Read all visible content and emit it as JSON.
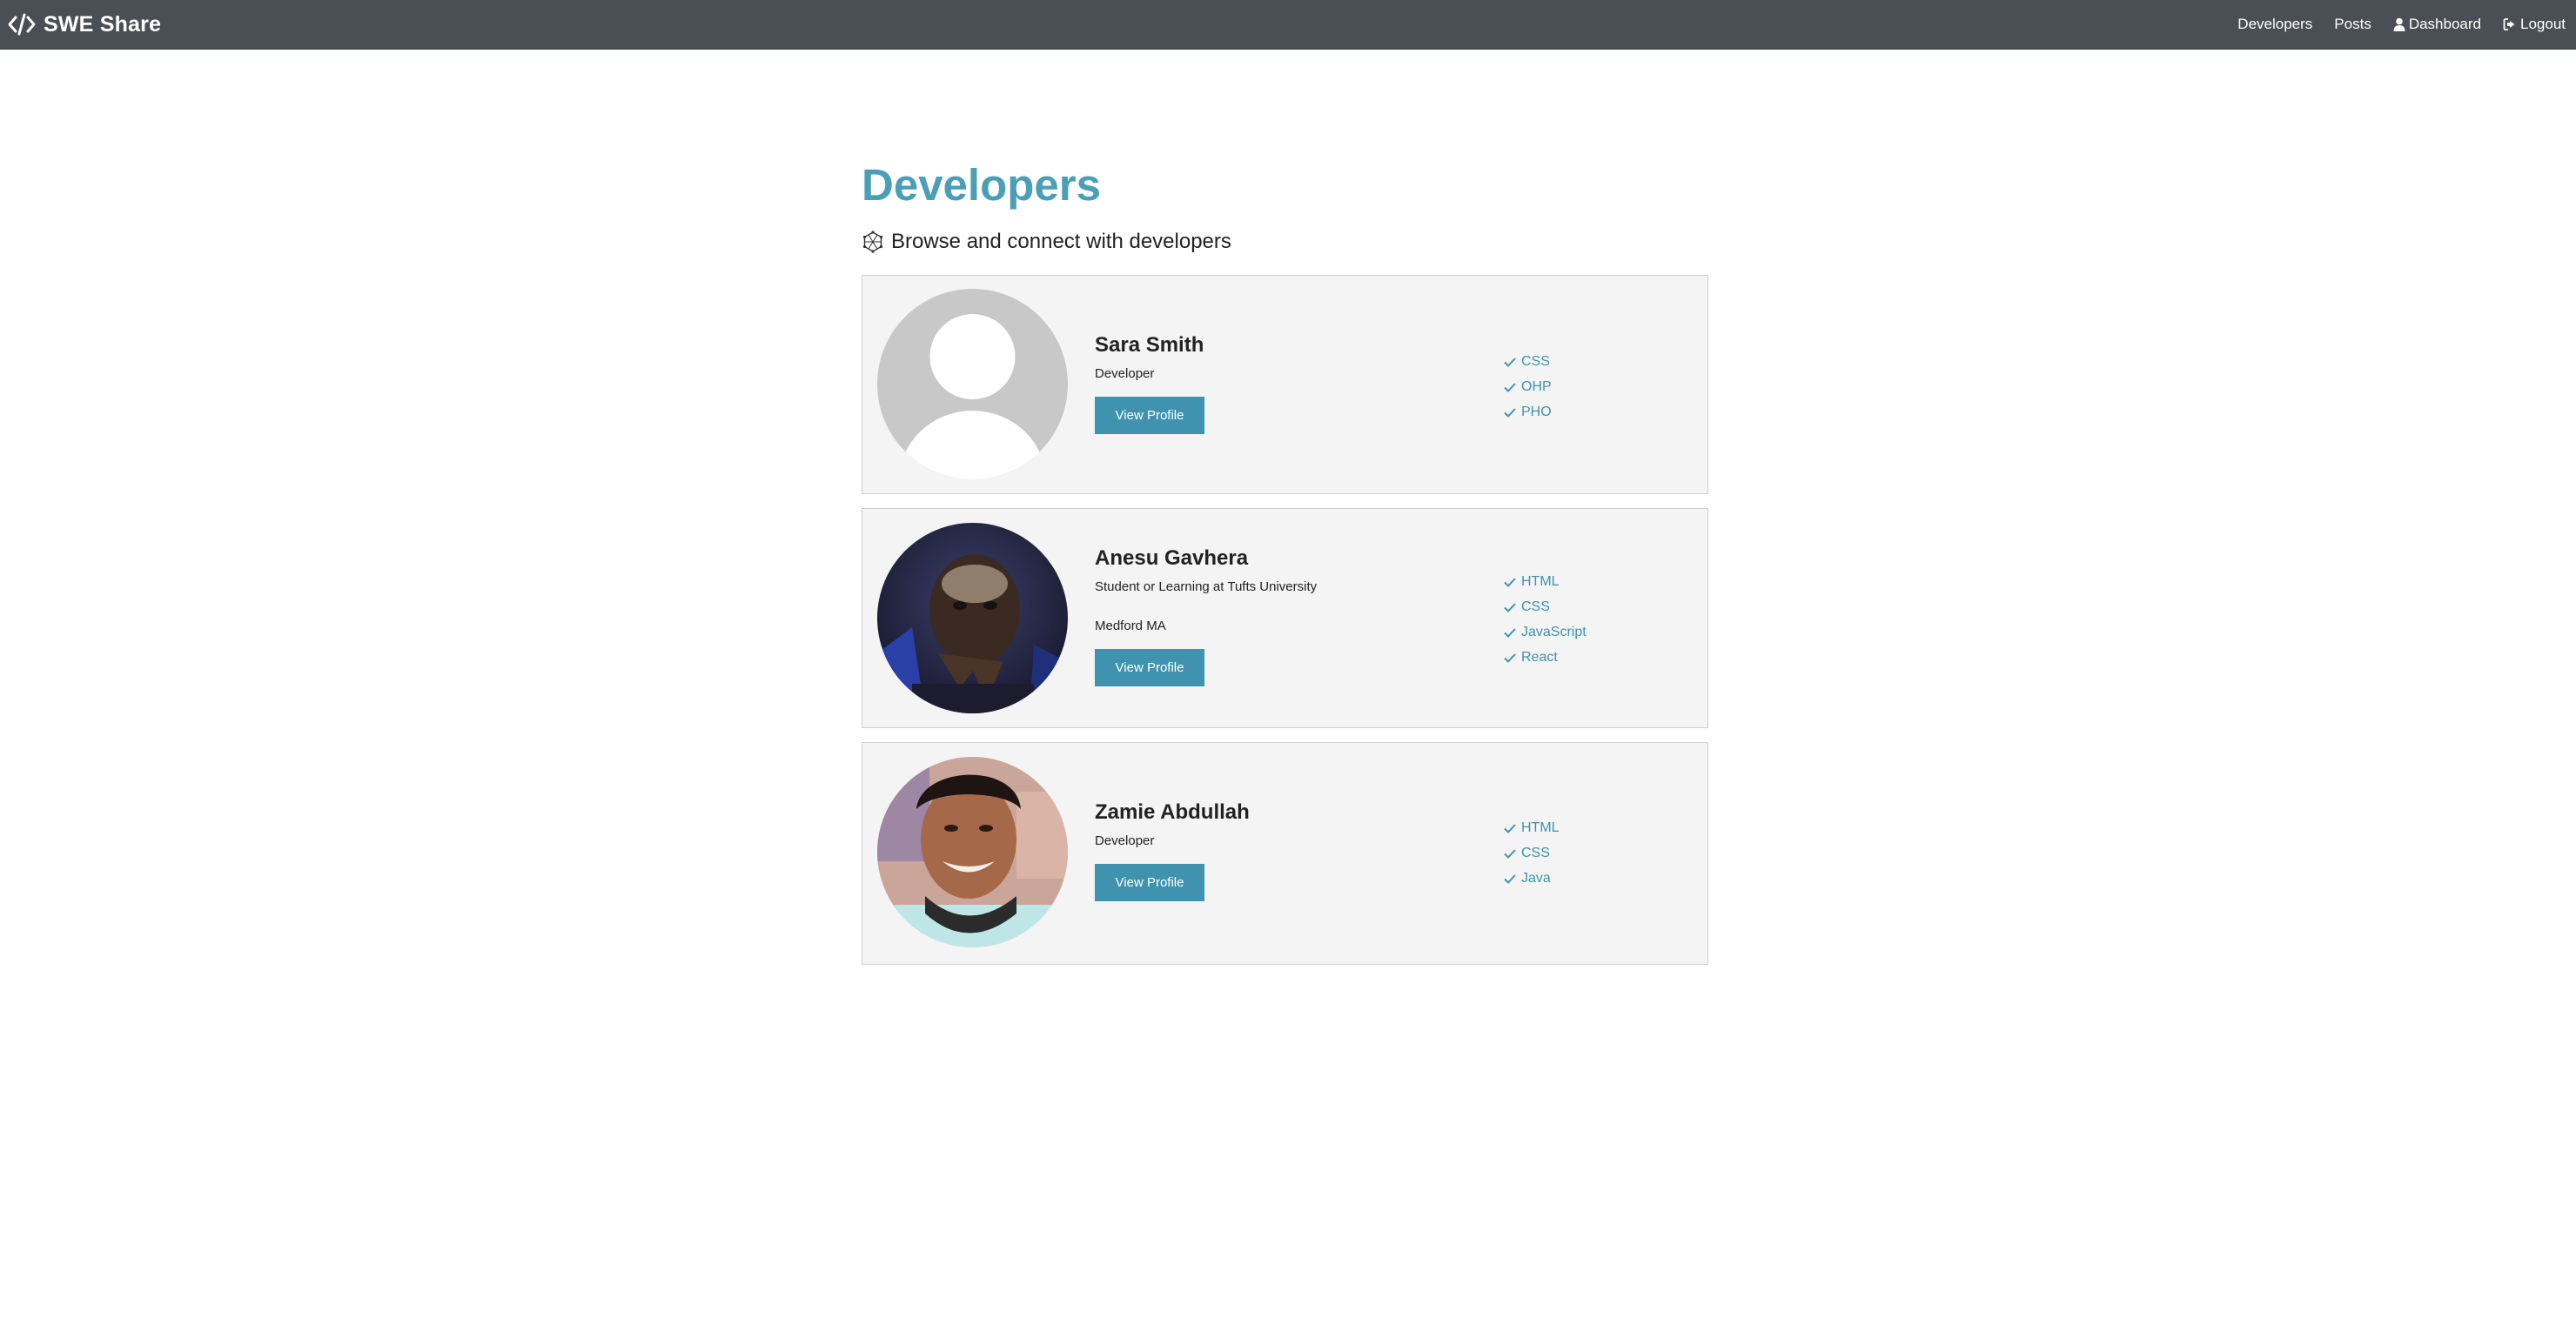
{
  "navbar": {
    "brand": "SWE Share",
    "links": [
      {
        "label": "Developers"
      },
      {
        "label": "Posts"
      },
      {
        "label": "Dashboard",
        "icon": "user-icon"
      },
      {
        "label": "Logout",
        "icon": "sign-out-icon"
      }
    ]
  },
  "page": {
    "title": "Developers",
    "lead": "Browse and connect with developers",
    "lead_icon": "connectdevelop-icon"
  },
  "profiles": [
    {
      "name": "Sara Smith",
      "status": "Developer",
      "location": "",
      "button": "View Profile",
      "avatar": "default-avatar",
      "skills": [
        "CSS",
        "OHP",
        "PHO"
      ]
    },
    {
      "name": "Anesu Gavhera",
      "status": "Student or Learning at Tufts University",
      "location": "Medford MA",
      "button": "View Profile",
      "avatar": "photo-avatar",
      "skills": [
        "HTML",
        "CSS",
        "JavaScript",
        "React"
      ]
    },
    {
      "name": "Zamie Abdullah",
      "status": "Developer",
      "location": "",
      "button": "View Profile",
      "avatar": "photo-avatar",
      "skills": [
        "HTML",
        "CSS",
        "Java"
      ]
    }
  ],
  "colors": {
    "navbar": "#4a4f55",
    "accent": "#3f93ae",
    "title": "#4a9eb5",
    "card_bg": "#f4f4f4"
  }
}
